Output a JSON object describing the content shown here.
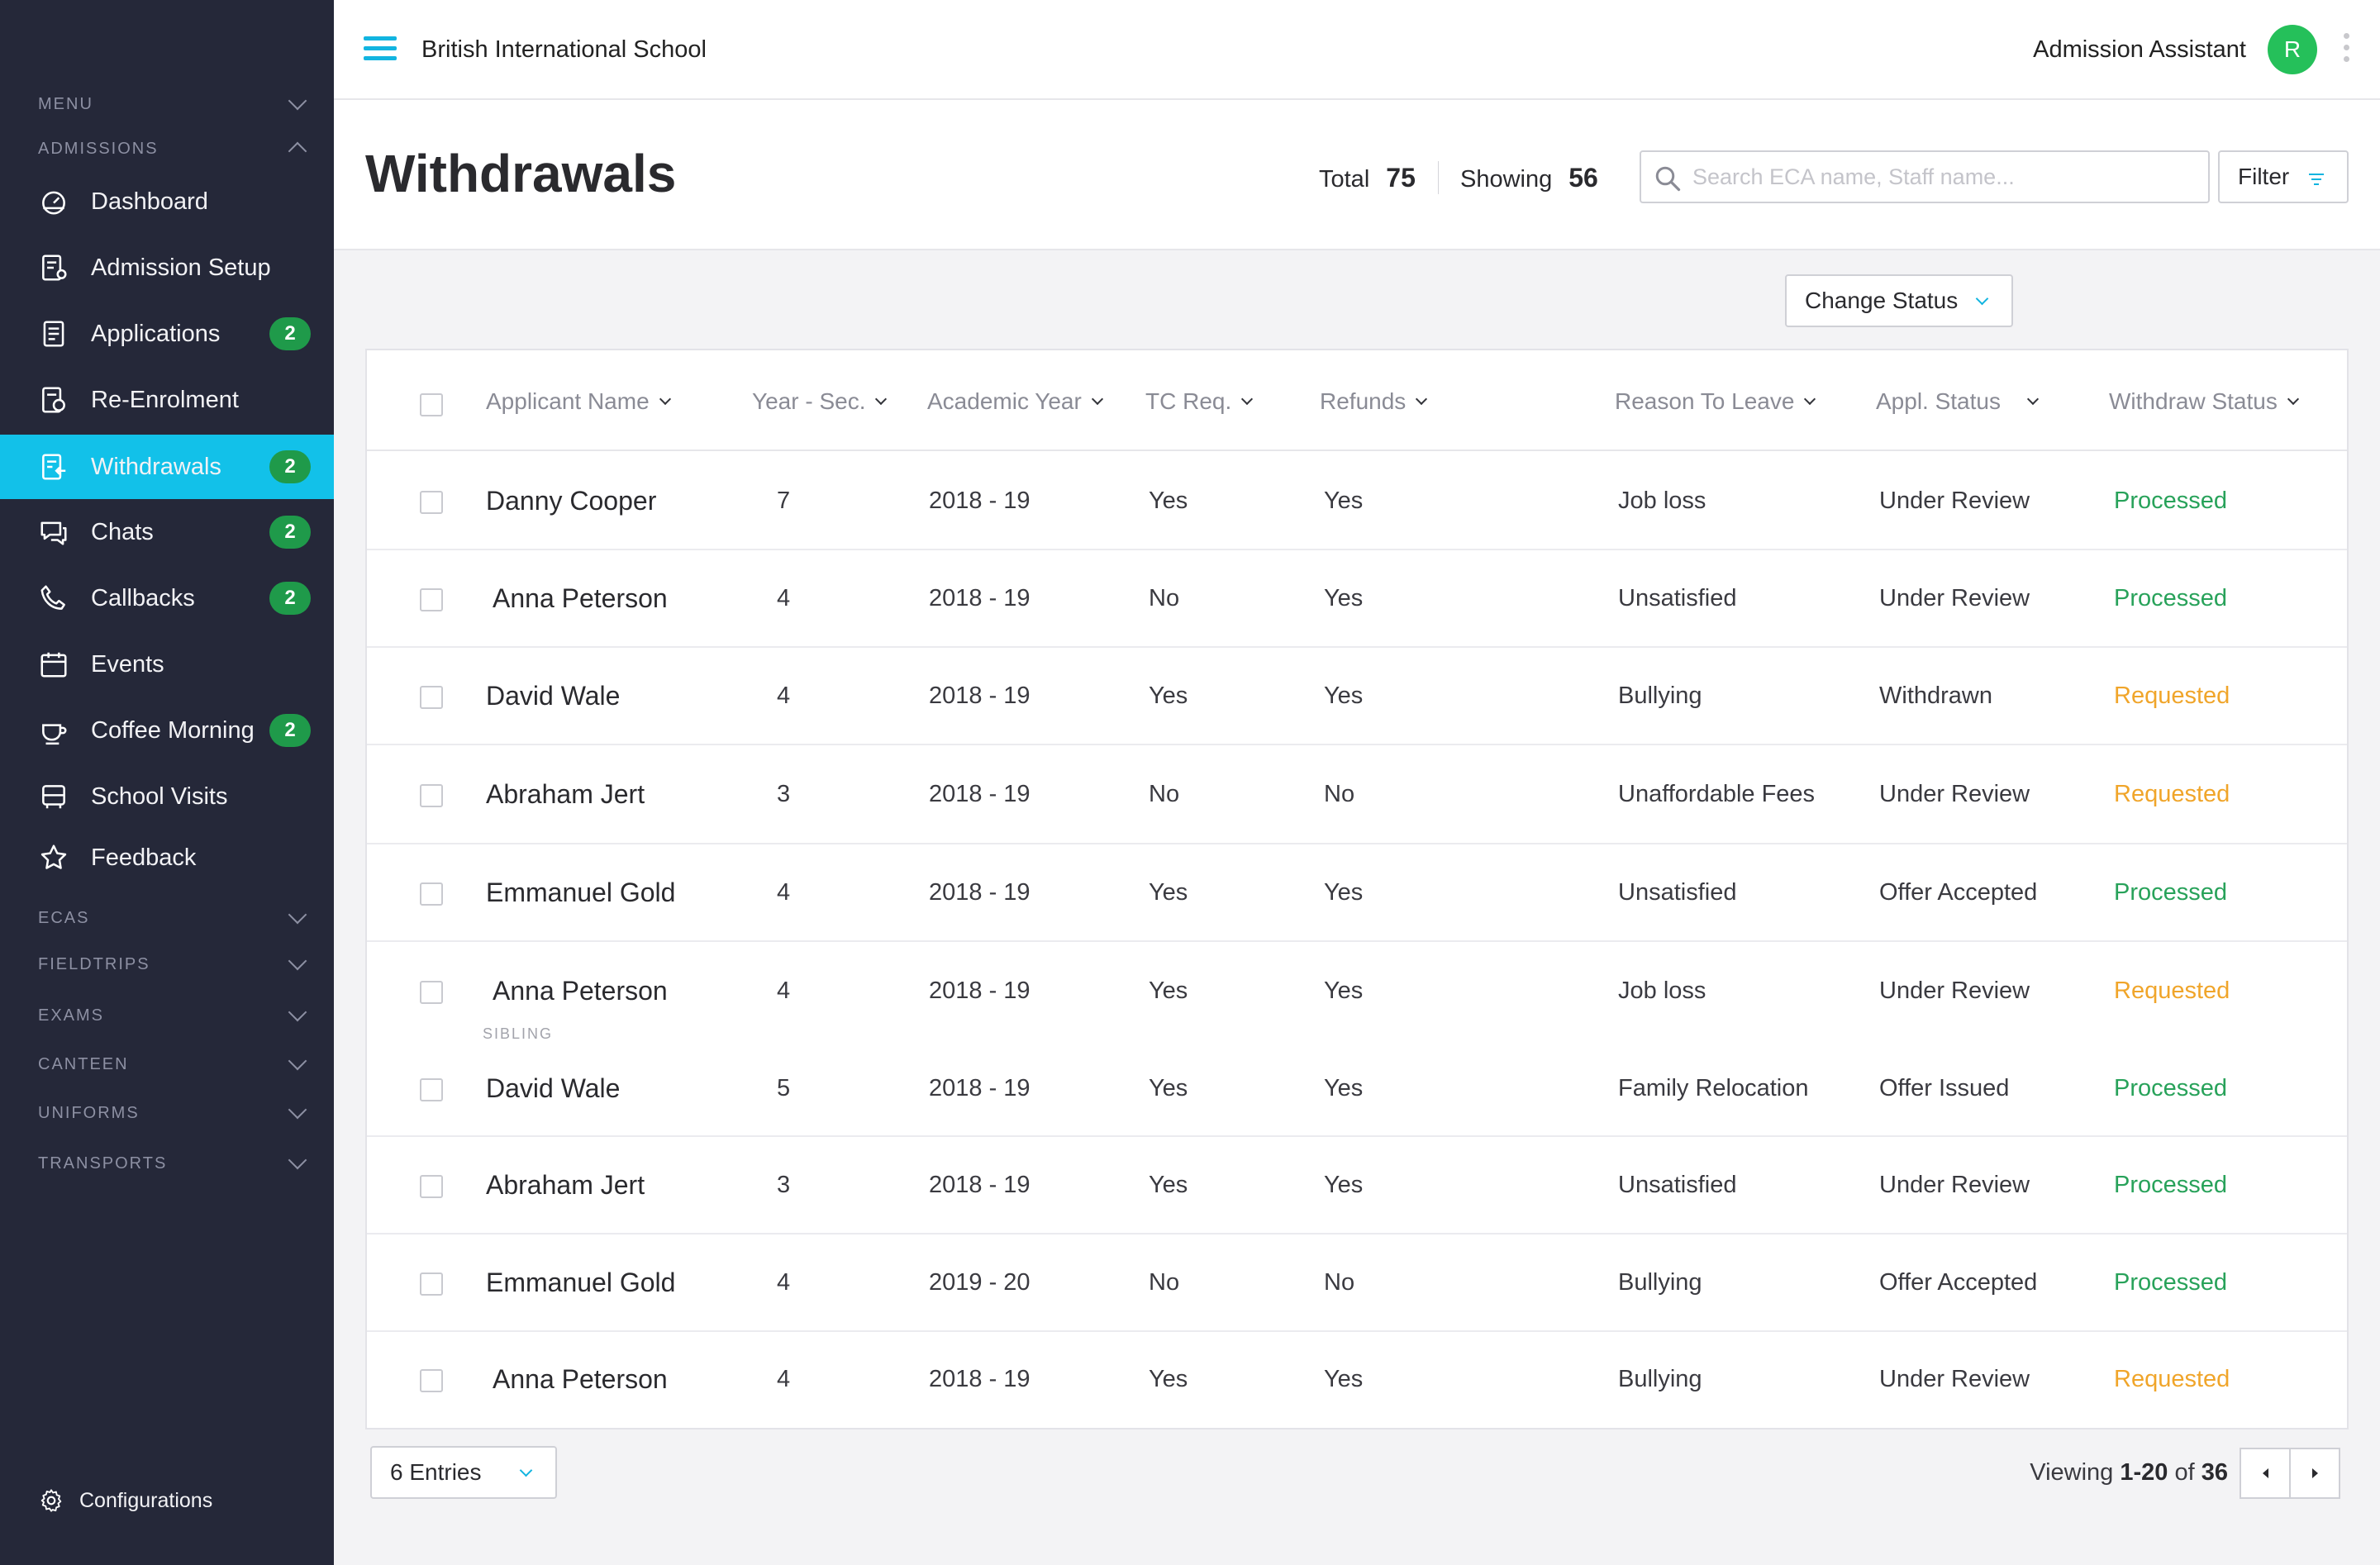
{
  "topbar": {
    "school": "British International School",
    "role": "Admission Assistant",
    "avatar_initial": "R"
  },
  "sidebar": {
    "sections_top": [
      {
        "label": "MENU",
        "expanded": false
      },
      {
        "label": "ADMISSIONS",
        "expanded": true
      }
    ],
    "items": [
      {
        "label": "Dashboard",
        "icon": "dashboard-icon",
        "badge": ""
      },
      {
        "label": "Admission Setup",
        "icon": "admission-setup-icon",
        "badge": ""
      },
      {
        "label": "Applications",
        "icon": "applications-icon",
        "badge": "2"
      },
      {
        "label": "Re-Enrolment",
        "icon": "re-enrolment-icon",
        "badge": ""
      },
      {
        "label": "Withdrawals",
        "icon": "withdrawals-icon",
        "badge": "2",
        "active": true
      },
      {
        "label": "Chats",
        "icon": "chats-icon",
        "badge": "2"
      },
      {
        "label": "Callbacks",
        "icon": "phone-icon",
        "badge": "2"
      },
      {
        "label": "Events",
        "icon": "calendar-icon",
        "badge": ""
      },
      {
        "label": "Coffee Morning",
        "icon": "coffee-cup-icon",
        "badge": "2"
      },
      {
        "label": "School Visits",
        "icon": "bus-icon",
        "badge": ""
      },
      {
        "label": "Feedback",
        "icon": "star-icon",
        "badge": ""
      }
    ],
    "sections_bottom": [
      "ECAS",
      "FIELDTRIPS",
      "EXAMS",
      "CANTEEN",
      "UNIFORMS",
      "TRANSPORTS"
    ],
    "footer_label": "Configurations"
  },
  "header": {
    "title": "Withdrawals",
    "total_label": "Total",
    "total_value": "75",
    "showing_label": "Showing",
    "showing_value": "56",
    "search_placeholder": "Search ECA name, Staff name...",
    "filter_label": "Filter",
    "change_status_label": "Change Status"
  },
  "table": {
    "columns": [
      "Applicant Name",
      "Year - Sec.",
      "Academic Year",
      "TC Req.",
      "Refunds",
      "Reason To Leave",
      "Appl. Status",
      "Withdraw Status"
    ],
    "rows": [
      {
        "name": "Danny Cooper",
        "year": "7",
        "academic": "2018 - 19",
        "tc": "Yes",
        "refunds": "Yes",
        "reason": "Job loss",
        "appl": "Under Review",
        "withdraw": "Processed",
        "state": "processed"
      },
      {
        "name": "Anna Peterson",
        "year": "4",
        "academic": "2018 - 19",
        "tc": "No",
        "refunds": "Yes",
        "reason": "Unsatisfied",
        "appl": "Under Review",
        "withdraw": "Processed",
        "state": "processed"
      },
      {
        "name": "David Wale",
        "year": "4",
        "academic": "2018 - 19",
        "tc": "Yes",
        "refunds": "Yes",
        "reason": "Bullying",
        "appl": "Withdrawn",
        "withdraw": "Requested",
        "state": "requested"
      },
      {
        "name": "Abraham Jert",
        "year": "3",
        "academic": "2018 - 19",
        "tc": "No",
        "refunds": "No",
        "reason": "Unaffordable Fees",
        "appl": "Under Review",
        "withdraw": "Requested",
        "state": "requested"
      },
      {
        "name": "Emmanuel Gold",
        "year": "4",
        "academic": "2018 - 19",
        "tc": "Yes",
        "refunds": "Yes",
        "reason": "Unsatisfied",
        "appl": "Offer Accepted",
        "withdraw": "Processed",
        "state": "processed"
      },
      {
        "name": "Anna Peterson",
        "year": "4",
        "academic": "2018 - 19",
        "tc": "Yes",
        "refunds": "Yes",
        "reason": "Job loss",
        "appl": "Under Review",
        "withdraw": "Requested",
        "state": "requested"
      },
      {
        "name": "David Wale",
        "year": "5",
        "academic": "2018 - 19",
        "tc": "Yes",
        "refunds": "Yes",
        "reason": "Family Relocation",
        "appl": "Offer Issued",
        "withdraw": "Processed",
        "state": "processed"
      },
      {
        "name": "Abraham Jert",
        "year": "3",
        "academic": "2018 - 19",
        "tc": "Yes",
        "refunds": "Yes",
        "reason": "Unsatisfied",
        "appl": "Under Review",
        "withdraw": "Processed",
        "state": "processed"
      },
      {
        "name": "Emmanuel Gold",
        "year": "4",
        "academic": "2019 - 20",
        "tc": "No",
        "refunds": "No",
        "reason": "Bullying",
        "appl": "Offer Accepted",
        "withdraw": "Processed",
        "state": "processed"
      },
      {
        "name": "Anna Peterson",
        "year": "4",
        "academic": "2018 - 19",
        "tc": "Yes",
        "refunds": "Yes",
        "reason": "Bullying",
        "appl": "Under Review",
        "withdraw": "Requested",
        "state": "requested"
      }
    ],
    "sibling_label": "SIBLING"
  },
  "footer": {
    "entries_label": "6 Entries",
    "viewing_prefix": "Viewing",
    "viewing_range": "1-20",
    "viewing_of": "of",
    "viewing_total": "36"
  },
  "colors": {
    "sidebar_bg": "#252839",
    "accent": "#12c1e9",
    "badge": "#1f9a4a",
    "processed": "#28a25a",
    "requested": "#f0a52a",
    "avatar": "#25c05a"
  }
}
